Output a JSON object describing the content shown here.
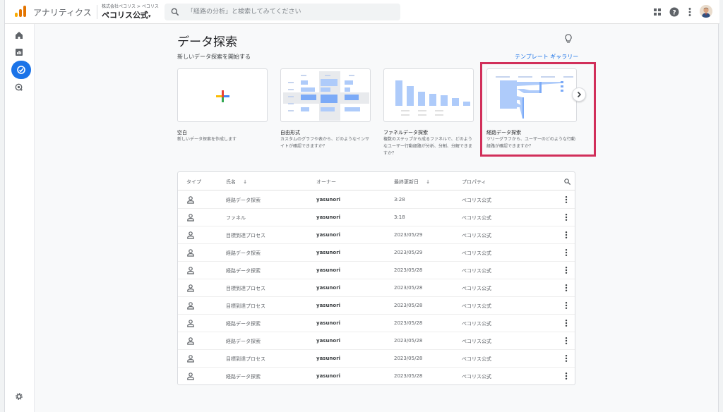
{
  "app": {
    "name": "アナリティクス",
    "account_path": "株式会社ペコリス > ペコリス",
    "property": "ペコリス公式",
    "property_caret": "▾"
  },
  "search": {
    "placeholder": "「経路の分析」と検索してみてください"
  },
  "header_icons": [
    "apps-grid-icon",
    "help-icon",
    "more-vert-icon",
    "avatar"
  ],
  "nav": {
    "items": [
      "home-icon",
      "reports-icon",
      "explore-icon",
      "advertising-icon"
    ],
    "active": "explore-icon",
    "footer": "settings-icon"
  },
  "page": {
    "title": "データ探索",
    "section_label": "新しいデータ探索を開始する",
    "gallery_link": "テンプレート ギャラリー"
  },
  "templates": [
    {
      "title": "空白",
      "description": "新しいデータ探索を作成します"
    },
    {
      "title": "自由形式",
      "description": "カスタムのグラフや表から、どのようなインサイトが確認できますか？"
    },
    {
      "title": "ファネルデータ探索",
      "description": "複数のステップから成るファネルで、どのようなユーザー行動経路が分析、分割、分解できますか？"
    },
    {
      "title": "経路データ探索",
      "description": "ツリーグラフから、ユーザーのどのような行動経路が確認できますか？"
    }
  ],
  "table": {
    "columns": {
      "type": "タイプ",
      "name": "氏名",
      "owner": "オーナー",
      "updated": "最終更新日",
      "property": "プロパティ"
    },
    "sort_arrow": "↓",
    "rows": [
      {
        "name": "経路データ探索",
        "owner": "yasunori",
        "updated": "3:28",
        "property": "ペコリス公式"
      },
      {
        "name": "ファネル",
        "owner": "yasunori",
        "updated": "3:18",
        "property": "ペコリス公式"
      },
      {
        "name": "目標到達プロセス",
        "owner": "yasunori",
        "updated": "2023/05/29",
        "property": "ペコリス公式"
      },
      {
        "name": "経路データ探索",
        "owner": "yasunori",
        "updated": "2023/05/29",
        "property": "ペコリス公式"
      },
      {
        "name": "経路データ探索",
        "owner": "yasunori",
        "updated": "2023/05/28",
        "property": "ペコリス公式"
      },
      {
        "name": "目標到達プロセス",
        "owner": "yasunori",
        "updated": "2023/05/28",
        "property": "ペコリス公式"
      },
      {
        "name": "目標到達プロセス",
        "owner": "yasunori",
        "updated": "2023/05/28",
        "property": "ペコリス公式"
      },
      {
        "name": "経路データ探索",
        "owner": "yasunori",
        "updated": "2023/05/28",
        "property": "ペコリス公式"
      },
      {
        "name": "経路データ探索",
        "owner": "yasunori",
        "updated": "2023/05/28",
        "property": "ペコリス公式"
      },
      {
        "name": "目標到達プロセス",
        "owner": "yasunori",
        "updated": "2023/05/28",
        "property": "ペコリス公式"
      },
      {
        "name": "経路データ探索",
        "owner": "yasunori",
        "updated": "2023/05/28",
        "property": "ペコリス公式"
      }
    ]
  },
  "colors": {
    "accent": "#1a73e8",
    "highlight": "#d12f5a",
    "logo": [
      "#f9ab00",
      "#e37400",
      "#e37400"
    ],
    "chart_blue": "#aecbfa"
  }
}
